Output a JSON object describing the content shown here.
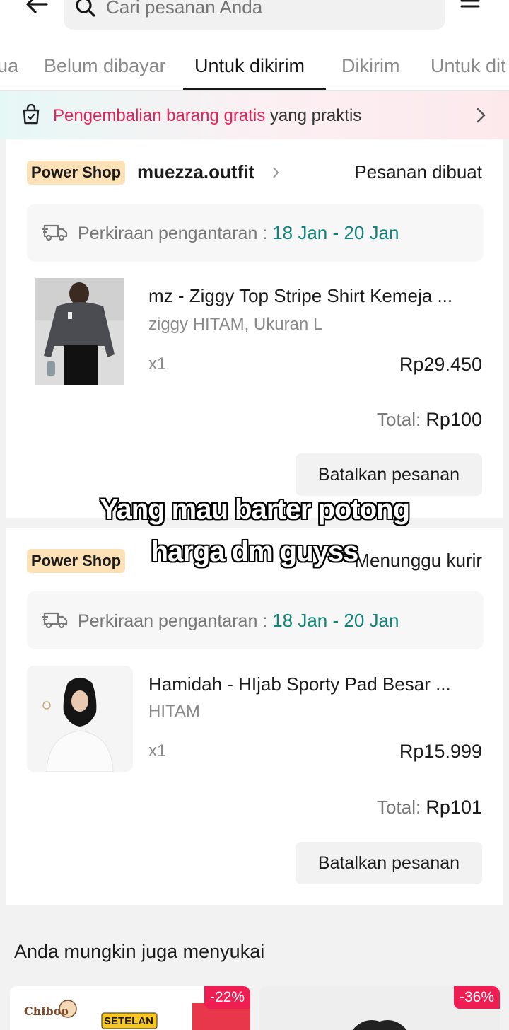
{
  "header": {
    "search_placeholder": "Cari pesanan Anda"
  },
  "tabs": [
    {
      "label": "ua"
    },
    {
      "label": "Belum dibayar"
    },
    {
      "label": "Untuk dikirim",
      "active": true
    },
    {
      "label": "Dikirim"
    },
    {
      "label": "Untuk dit"
    }
  ],
  "banner": {
    "highlight": "Pengembalian barang gratis",
    "rest": " yang praktis"
  },
  "orders": [
    {
      "badge": "Power Shop",
      "shop": "muezza.outfit",
      "status": "Pesanan dibuat",
      "eta_label": "Perkiraan pengantaran : ",
      "eta_date": "18 Jan - 20 Jan",
      "product": "mz - Ziggy Top Stripe Shirt Kemeja ...",
      "variant": "ziggy HITAM, Ukuran L",
      "qty": "x1",
      "price": "Rp29.450",
      "total_label": "Total: ",
      "total": "Rp100",
      "cancel": "Batalkan pesanan"
    },
    {
      "badge": "Power Shop",
      "status": "Menunggu kurir",
      "eta_label": "Perkiraan pengantaran : ",
      "eta_date": "18 Jan - 20 Jan",
      "product": "Hamidah - HIjab Sporty Pad Besar ...",
      "variant": "HITAM",
      "qty": "x1",
      "price": "Rp15.999",
      "total_label": "Total: ",
      "total": "Rp101",
      "cancel": "Batalkan pesanan"
    }
  ],
  "caption": {
    "line1": "Yang mau barter potong",
    "line2": "harga dm guyss"
  },
  "recommend": {
    "title": "Anda mungkin juga menyukai",
    "items": [
      {
        "discount": "-22%",
        "brand": "Chiboo",
        "tag": "SETELAN"
      },
      {
        "discount": "-36%"
      }
    ]
  }
}
